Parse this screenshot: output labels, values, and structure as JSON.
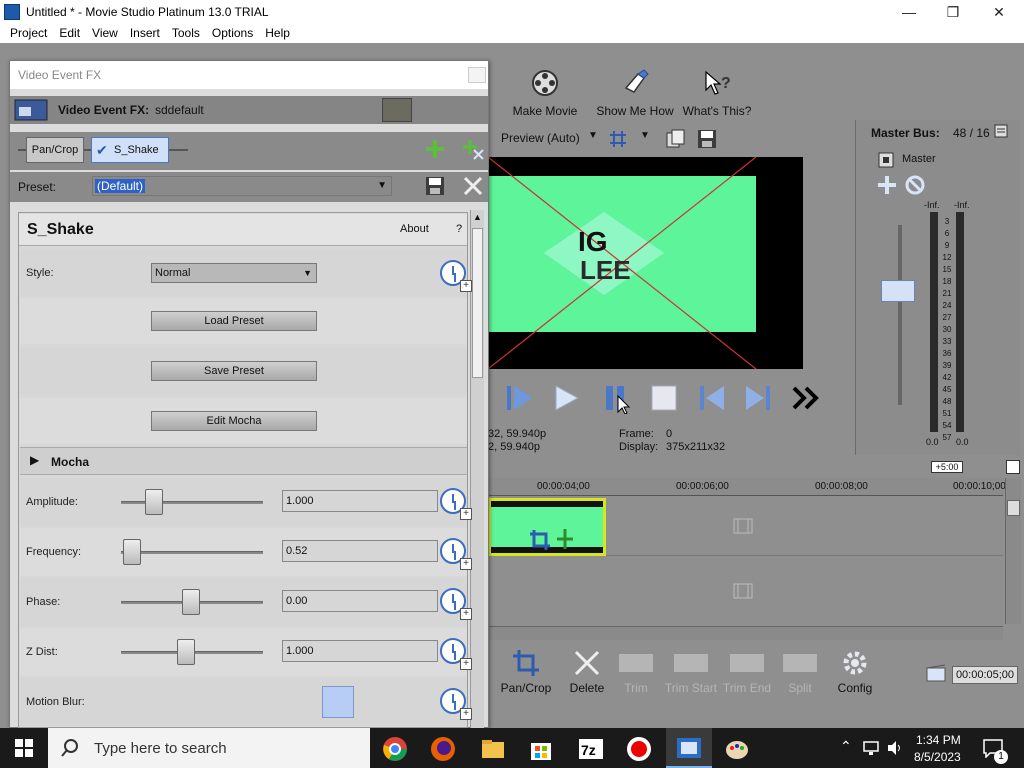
{
  "window": {
    "title": "Untitled * - Movie Studio Platinum 13.0 TRIAL",
    "minimize": "—",
    "maximize": "❐",
    "close": "✕"
  },
  "menu": [
    "Project",
    "Edit",
    "View",
    "Insert",
    "Tools",
    "Options",
    "Help"
  ],
  "toolbar": {
    "make_movie": "Make Movie",
    "show_me_how": "Show Me How",
    "whats_this": "What's This?"
  },
  "preview": {
    "mode": "Preview (Auto)",
    "project_info": "32, 59.940p",
    "preview_info": "2, 59.940p",
    "frame_label": "Frame:",
    "frame_value": "0",
    "display_label": "Display:",
    "display_value": "375x211x32",
    "logo_text_1": "IG",
    "logo_text_2": "LEE"
  },
  "master": {
    "title": "Master Bus:",
    "channels": "48 / 16",
    "label": "Master",
    "inf_left": "-Inf.",
    "inf_right": "-Inf.",
    "scale": [
      "3",
      "6",
      "9",
      "12",
      "15",
      "18",
      "21",
      "24",
      "27",
      "30",
      "33",
      "36",
      "39",
      "42",
      "45",
      "48",
      "51",
      "54",
      "57"
    ],
    "zero_left": "0.0",
    "zero_right": "0.0"
  },
  "timeline": {
    "offset": "+5:00",
    "ticks": [
      "00:00:04;00",
      "00:00:06;00",
      "00:00:08;00",
      "00:00:10;00"
    ],
    "end_time": "00:00:05;00"
  },
  "bottom_tools": {
    "pan_crop": "Pan/Crop",
    "delete": "Delete",
    "trim": "Trim",
    "trim_start": "Trim Start",
    "trim_end": "Trim End",
    "split": "Split",
    "config": "Config"
  },
  "dialog": {
    "title": "Video Event FX",
    "fx_label": "Video Event FX:",
    "fx_name": "sddefault",
    "chain": [
      "Pan/Crop",
      "S_Shake"
    ],
    "preset_label": "Preset:",
    "preset_value": "(Default)",
    "plugin_name": "S_Shake",
    "about": "About",
    "help": "?",
    "style_label": "Style:",
    "style_value": "Normal",
    "load_preset": "Load Preset",
    "save_preset": "Save Preset",
    "edit_mocha": "Edit Mocha",
    "mocha_section": "Mocha",
    "params": [
      {
        "label": "Amplitude:",
        "value": "1.000",
        "level": 0.19
      },
      {
        "label": "Frequency:",
        "value": "0.52",
        "level": 0.02
      },
      {
        "label": "Phase:",
        "value": "0.00",
        "level": 0.49
      },
      {
        "label": "Z Dist:",
        "value": "1.000",
        "level": 0.45
      }
    ],
    "motion_blur_label": "Motion Blur:"
  },
  "taskbar": {
    "search_placeholder": "Type here to search",
    "time": "1:34 PM",
    "date": "8/5/2023",
    "notifications": "1"
  },
  "colors": {
    "preview_green": "#5ef59a",
    "clip_border": "#d7e61a",
    "accent_blue": "#3b6dc0"
  }
}
